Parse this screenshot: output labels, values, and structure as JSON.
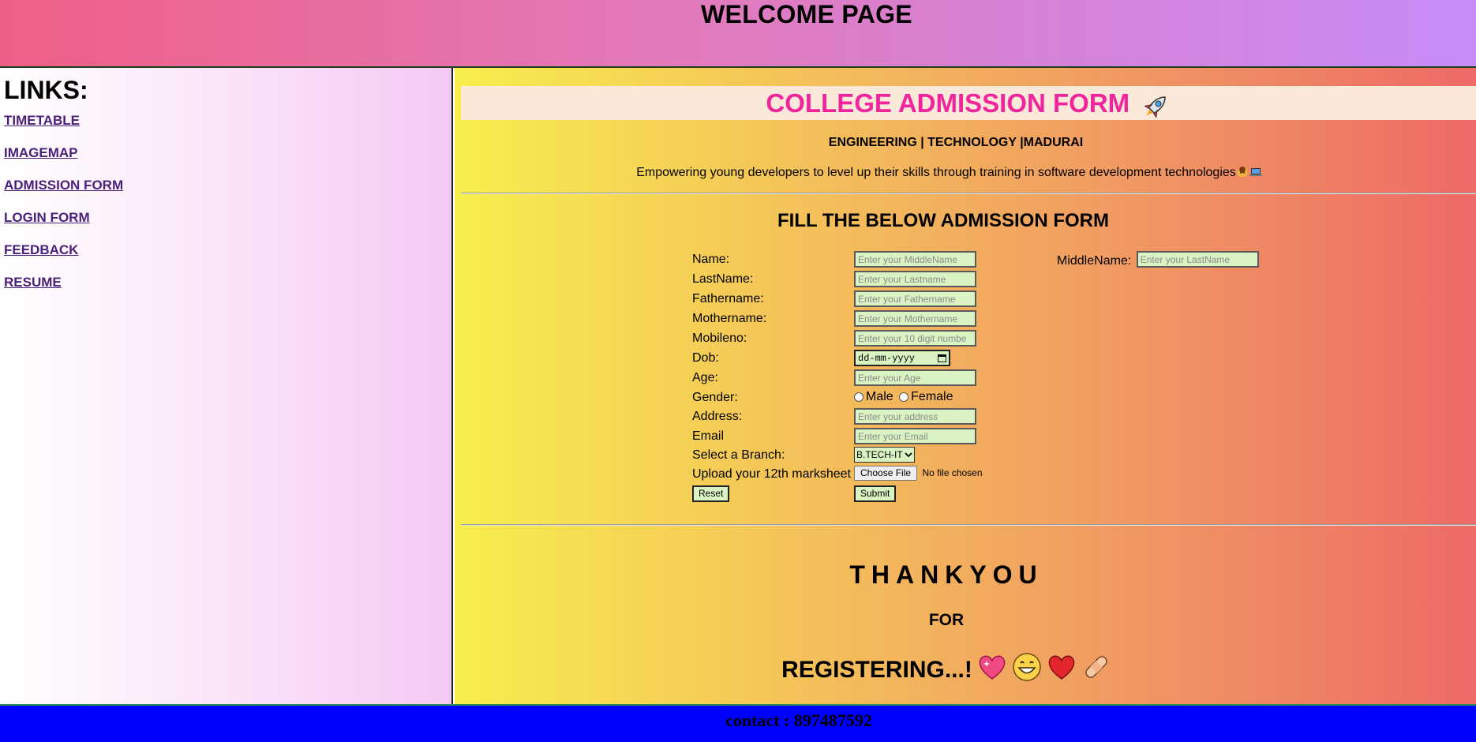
{
  "header": {
    "title": "WELCOME PAGE"
  },
  "sidebar": {
    "heading": "LINKS:",
    "links": [
      "TIMETABLE",
      "IMAGEMAP",
      "ADMISSION FORM",
      "LOGIN FORM",
      "FEEDBACK",
      "RESUME"
    ]
  },
  "main": {
    "title": "COLLEGE ADMISSION FORM",
    "tagline1": "ENGINEERING | TECHNOLOGY |MADURAI",
    "tagline2": "Empowering young developers to level up their skills through training in software development technologies",
    "form_title": "FILL THE BELOW ADMISSION FORM",
    "form": {
      "name_label": "Name:",
      "name_placeholder": "Enter your MiddleName",
      "middlename_label": "MiddleName:",
      "middlename_placeholder": "Enter your LastName",
      "lastname_label": "LastName:",
      "lastname_placeholder": "Enter your Lastname",
      "fathername_label": "Fathername:",
      "fathername_placeholder": "Enter your Fathername",
      "mothername_label": "Mothername:",
      "mothername_placeholder": "Enter your Mothername",
      "mobile_label": "Mobileno:",
      "mobile_placeholder": "Enter your 10 digit numbe",
      "dob_label": "Dob:",
      "dob_placeholder": "dd-mm-yyyy",
      "age_label": "Age:",
      "age_placeholder": "Enter your Age",
      "gender_label": "Gender:",
      "gender_options": [
        "Male",
        "Female"
      ],
      "address_label": "Address:",
      "address_placeholder": "Enter your address",
      "email_label": "Email",
      "email_placeholder": "Enter your Email",
      "branch_label": "Select a Branch:",
      "branch_selected": "B.TECH-IT",
      "upload_label": "Upload your 12th marksheet",
      "upload_button": "Choose File",
      "upload_status": "No file chosen",
      "reset_label": "Reset",
      "submit_label": "Submit"
    },
    "thanks1": "THANKYOU",
    "thanks2": "FOR",
    "thanks3": "REGISTERING...!"
  },
  "footer": {
    "contact": "contact : 897487592"
  }
}
